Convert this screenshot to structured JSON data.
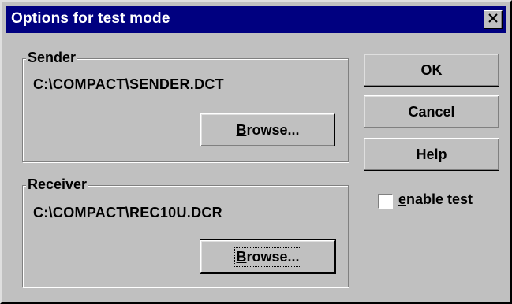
{
  "window": {
    "title": "Options for test mode",
    "close_glyph": "✕"
  },
  "sender": {
    "label": "Sender",
    "path": "C:\\COMPACT\\SENDER.DCT",
    "browse_label": "Browse...",
    "browse_mnemonic": "B",
    "browse_rest": "rowse..."
  },
  "receiver": {
    "label": "Receiver",
    "path": "C:\\COMPACT\\REC10U.DCR",
    "browse_label": "Browse...",
    "browse_mnemonic": "B",
    "browse_rest": "rowse..."
  },
  "buttons": {
    "ok": "OK",
    "cancel": "Cancel",
    "help": "Help"
  },
  "enable_test": {
    "label": "enable test",
    "mnemonic": "e",
    "rest": "nable test",
    "checked": false
  },
  "colors": {
    "titlebar": "#000080",
    "face": "#c0c0c0"
  }
}
